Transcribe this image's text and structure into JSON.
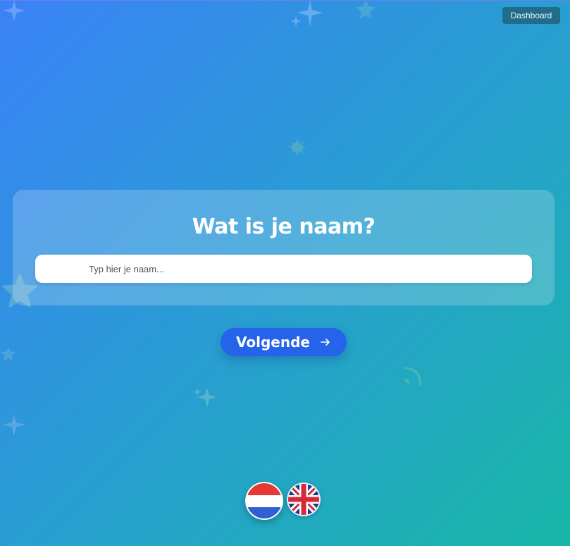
{
  "header": {
    "dashboard_label": "Dashboard"
  },
  "main": {
    "title": "Wat is je naam?",
    "name_input": {
      "placeholder": "Typ hier je naam...",
      "value": ""
    },
    "next_label": "Volgende"
  },
  "languages": [
    {
      "code": "nl",
      "icon": "netherlands-flag-icon",
      "selected": true
    },
    {
      "code": "en",
      "icon": "united-kingdom-flag-icon",
      "selected": false
    }
  ],
  "colors": {
    "gradient_start": "#3b82f6",
    "gradient_end": "#19b7a8",
    "button": "#2563eb",
    "dashboard_button": "#216c88"
  }
}
